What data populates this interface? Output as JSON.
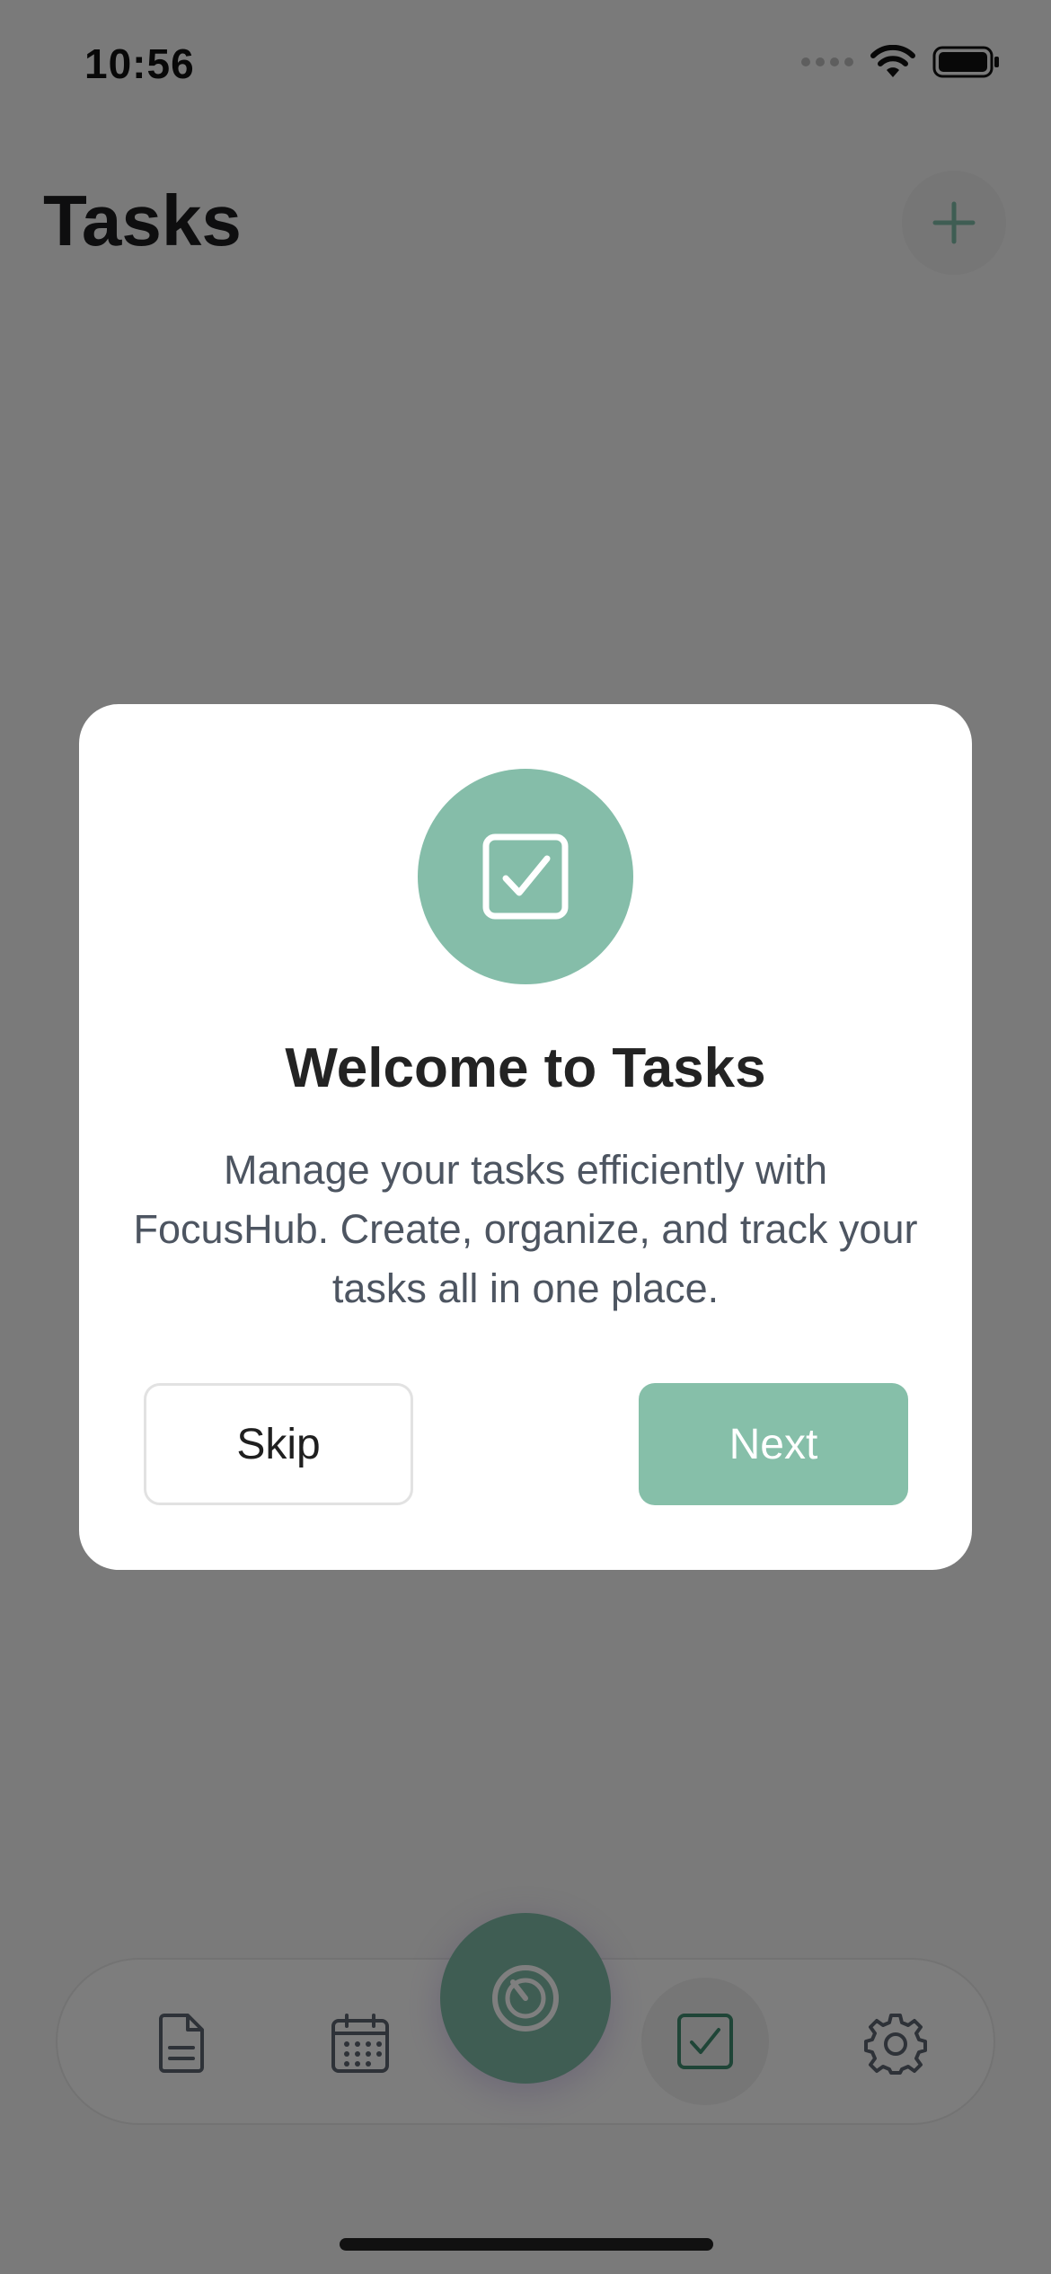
{
  "status_bar": {
    "time": "10:56"
  },
  "header": {
    "title": "Tasks",
    "add_button_icon": "plus-icon"
  },
  "modal": {
    "icon": "checkbox-icon",
    "title": "Welcome to Tasks",
    "description": "Manage your tasks efficiently with FocusHub. Create, organize, and track your tasks all in one place.",
    "skip_label": "Skip",
    "next_label": "Next"
  },
  "tab_bar": {
    "items": [
      {
        "icon": "document-icon",
        "active": false
      },
      {
        "icon": "calendar-icon",
        "active": false
      },
      {
        "icon": "timer-icon",
        "active": false,
        "center_fab": true
      },
      {
        "icon": "checkbox-icon",
        "active": true
      },
      {
        "icon": "gear-icon",
        "active": false
      }
    ]
  },
  "colors": {
    "accent": "#85BDA9",
    "overlay": "rgba(0,0,0,0.5)",
    "title_text": "#232323",
    "body_text": "#4D5561"
  }
}
